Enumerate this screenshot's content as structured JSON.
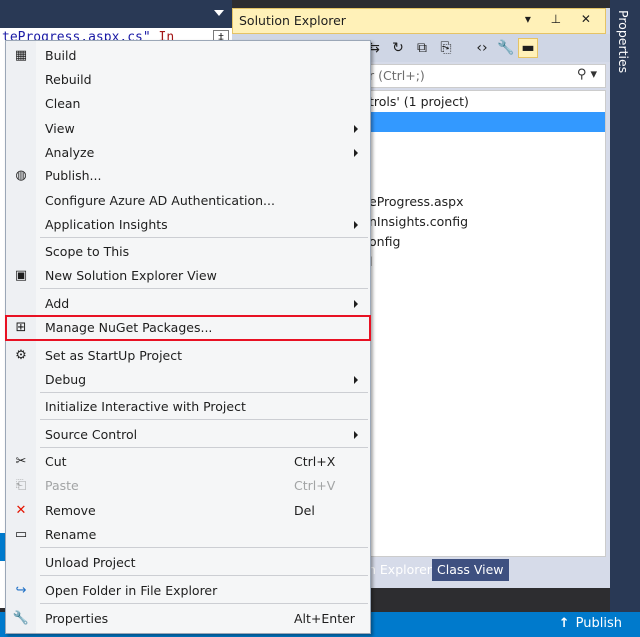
{
  "editor": {
    "code_blue": "teProgress.aspx.cs\"",
    "code_red": "In",
    "scroll_glyph": "‡"
  },
  "solution_explorer": {
    "title": "Solution Explorer",
    "controls": "▾ ⊥ ✕",
    "search_placeholder": "r (Ctrl+;)",
    "tree": [
      "trols' (1 project)",
      "",
      "eProgress.aspx",
      "nInsights.config",
      "onfig",
      "l"
    ],
    "tabs": [
      "n Explorer",
      "Class View"
    ]
  },
  "properties_bar": {
    "label": "Properties"
  },
  "status_bar": {
    "publish": "Publish"
  },
  "menu": {
    "items": [
      {
        "label": "Build",
        "icon": "build-icon",
        "glyph": "▦"
      },
      {
        "label": "Rebuild"
      },
      {
        "label": "Clean"
      },
      {
        "label": "View",
        "submenu": true
      },
      {
        "label": "Analyze",
        "submenu": true
      },
      {
        "label": "Publish...",
        "icon": "globe-icon",
        "glyph": "🌐"
      },
      {
        "label": "Configure Azure AD Authentication..."
      },
      {
        "label": "Application Insights",
        "submenu": true
      },
      {
        "label": "Scope to This"
      },
      {
        "label": "New Solution Explorer View",
        "icon": "new-view-icon",
        "glyph": "▣"
      },
      {
        "label": "Add",
        "submenu": true
      },
      {
        "label": "Manage NuGet Packages...",
        "icon": "nuget-package-icon",
        "glyph": "⊞"
      },
      {
        "label": "Set as StartUp Project",
        "icon": "gear-icon",
        "glyph": "⚙"
      },
      {
        "label": "Debug",
        "submenu": true
      },
      {
        "label": "Initialize Interactive with Project"
      },
      {
        "label": "Source Control",
        "submenu": true
      },
      {
        "label": "Cut",
        "icon": "scissors-icon",
        "glyph": "✂",
        "shortcut": "Ctrl+X"
      },
      {
        "label": "Paste",
        "icon": "paste-icon",
        "glyph": "📋",
        "shortcut": "Ctrl+V",
        "disabled": true
      },
      {
        "label": "Remove",
        "icon": "remove-x-icon",
        "glyph": "✕",
        "shortcut": "Del"
      },
      {
        "label": "Rename",
        "icon": "rename-icon",
        "glyph": "▭"
      },
      {
        "label": "Unload Project"
      },
      {
        "label": "Open Folder in File Explorer",
        "icon": "open-folder-arrow-icon",
        "glyph": "↪"
      },
      {
        "label": "Properties",
        "icon": "wrench-icon",
        "glyph": "🔧",
        "shortcut": "Alt+Enter"
      }
    ]
  },
  "colors": {
    "highlight_border": "#e81123",
    "accent_blue": "#007acc",
    "selection_blue": "#3399ff",
    "remove_icon_red": "#e51400"
  }
}
